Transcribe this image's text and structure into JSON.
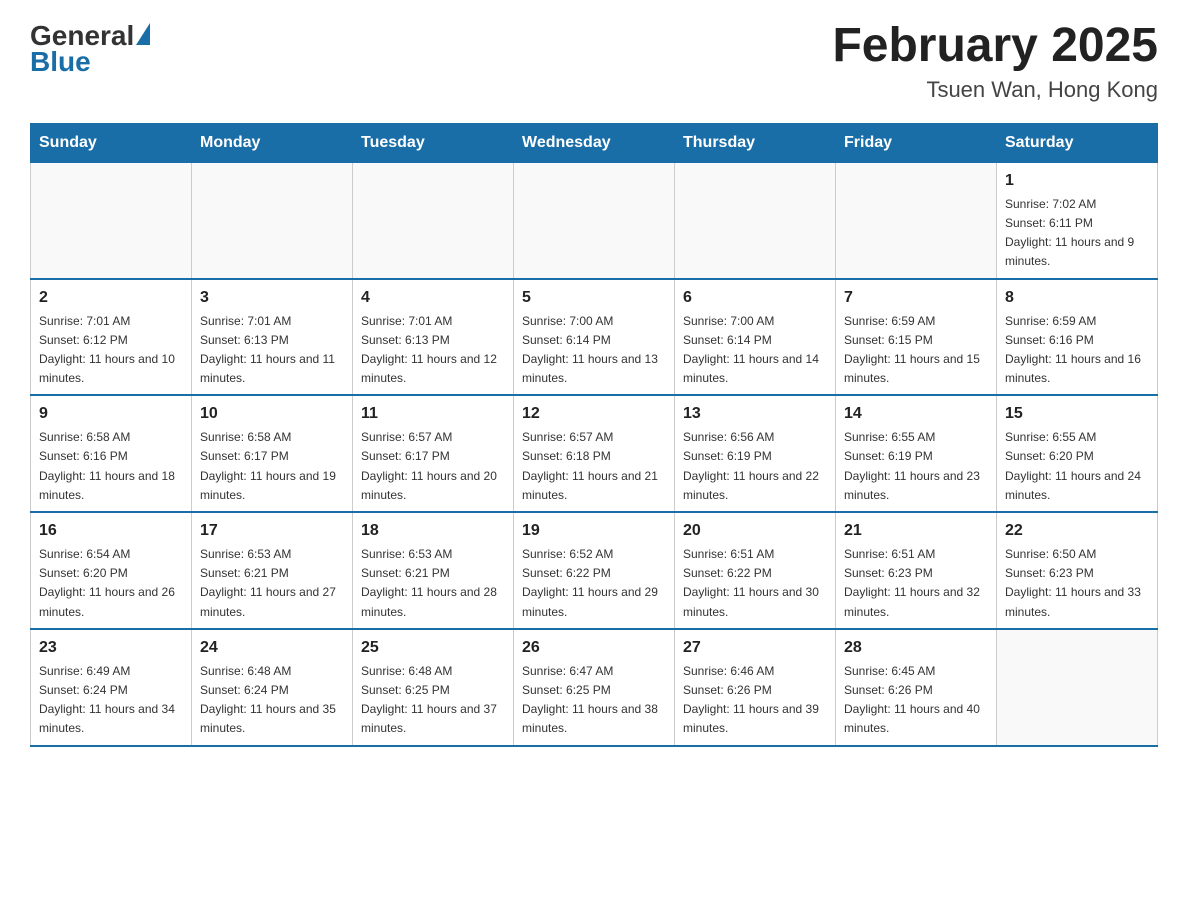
{
  "header": {
    "logo_general": "General",
    "logo_blue": "Blue",
    "title": "February 2025",
    "subtitle": "Tsuen Wan, Hong Kong"
  },
  "days_of_week": [
    "Sunday",
    "Monday",
    "Tuesday",
    "Wednesday",
    "Thursday",
    "Friday",
    "Saturday"
  ],
  "weeks": [
    [
      {
        "date": "",
        "info": ""
      },
      {
        "date": "",
        "info": ""
      },
      {
        "date": "",
        "info": ""
      },
      {
        "date": "",
        "info": ""
      },
      {
        "date": "",
        "info": ""
      },
      {
        "date": "",
        "info": ""
      },
      {
        "date": "1",
        "info": "Sunrise: 7:02 AM\nSunset: 6:11 PM\nDaylight: 11 hours and 9 minutes."
      }
    ],
    [
      {
        "date": "2",
        "info": "Sunrise: 7:01 AM\nSunset: 6:12 PM\nDaylight: 11 hours and 10 minutes."
      },
      {
        "date": "3",
        "info": "Sunrise: 7:01 AM\nSunset: 6:13 PM\nDaylight: 11 hours and 11 minutes."
      },
      {
        "date": "4",
        "info": "Sunrise: 7:01 AM\nSunset: 6:13 PM\nDaylight: 11 hours and 12 minutes."
      },
      {
        "date": "5",
        "info": "Sunrise: 7:00 AM\nSunset: 6:14 PM\nDaylight: 11 hours and 13 minutes."
      },
      {
        "date": "6",
        "info": "Sunrise: 7:00 AM\nSunset: 6:14 PM\nDaylight: 11 hours and 14 minutes."
      },
      {
        "date": "7",
        "info": "Sunrise: 6:59 AM\nSunset: 6:15 PM\nDaylight: 11 hours and 15 minutes."
      },
      {
        "date": "8",
        "info": "Sunrise: 6:59 AM\nSunset: 6:16 PM\nDaylight: 11 hours and 16 minutes."
      }
    ],
    [
      {
        "date": "9",
        "info": "Sunrise: 6:58 AM\nSunset: 6:16 PM\nDaylight: 11 hours and 18 minutes."
      },
      {
        "date": "10",
        "info": "Sunrise: 6:58 AM\nSunset: 6:17 PM\nDaylight: 11 hours and 19 minutes."
      },
      {
        "date": "11",
        "info": "Sunrise: 6:57 AM\nSunset: 6:17 PM\nDaylight: 11 hours and 20 minutes."
      },
      {
        "date": "12",
        "info": "Sunrise: 6:57 AM\nSunset: 6:18 PM\nDaylight: 11 hours and 21 minutes."
      },
      {
        "date": "13",
        "info": "Sunrise: 6:56 AM\nSunset: 6:19 PM\nDaylight: 11 hours and 22 minutes."
      },
      {
        "date": "14",
        "info": "Sunrise: 6:55 AM\nSunset: 6:19 PM\nDaylight: 11 hours and 23 minutes."
      },
      {
        "date": "15",
        "info": "Sunrise: 6:55 AM\nSunset: 6:20 PM\nDaylight: 11 hours and 24 minutes."
      }
    ],
    [
      {
        "date": "16",
        "info": "Sunrise: 6:54 AM\nSunset: 6:20 PM\nDaylight: 11 hours and 26 minutes."
      },
      {
        "date": "17",
        "info": "Sunrise: 6:53 AM\nSunset: 6:21 PM\nDaylight: 11 hours and 27 minutes."
      },
      {
        "date": "18",
        "info": "Sunrise: 6:53 AM\nSunset: 6:21 PM\nDaylight: 11 hours and 28 minutes."
      },
      {
        "date": "19",
        "info": "Sunrise: 6:52 AM\nSunset: 6:22 PM\nDaylight: 11 hours and 29 minutes."
      },
      {
        "date": "20",
        "info": "Sunrise: 6:51 AM\nSunset: 6:22 PM\nDaylight: 11 hours and 30 minutes."
      },
      {
        "date": "21",
        "info": "Sunrise: 6:51 AM\nSunset: 6:23 PM\nDaylight: 11 hours and 32 minutes."
      },
      {
        "date": "22",
        "info": "Sunrise: 6:50 AM\nSunset: 6:23 PM\nDaylight: 11 hours and 33 minutes."
      }
    ],
    [
      {
        "date": "23",
        "info": "Sunrise: 6:49 AM\nSunset: 6:24 PM\nDaylight: 11 hours and 34 minutes."
      },
      {
        "date": "24",
        "info": "Sunrise: 6:48 AM\nSunset: 6:24 PM\nDaylight: 11 hours and 35 minutes."
      },
      {
        "date": "25",
        "info": "Sunrise: 6:48 AM\nSunset: 6:25 PM\nDaylight: 11 hours and 37 minutes."
      },
      {
        "date": "26",
        "info": "Sunrise: 6:47 AM\nSunset: 6:25 PM\nDaylight: 11 hours and 38 minutes."
      },
      {
        "date": "27",
        "info": "Sunrise: 6:46 AM\nSunset: 6:26 PM\nDaylight: 11 hours and 39 minutes."
      },
      {
        "date": "28",
        "info": "Sunrise: 6:45 AM\nSunset: 6:26 PM\nDaylight: 11 hours and 40 minutes."
      },
      {
        "date": "",
        "info": ""
      }
    ]
  ]
}
